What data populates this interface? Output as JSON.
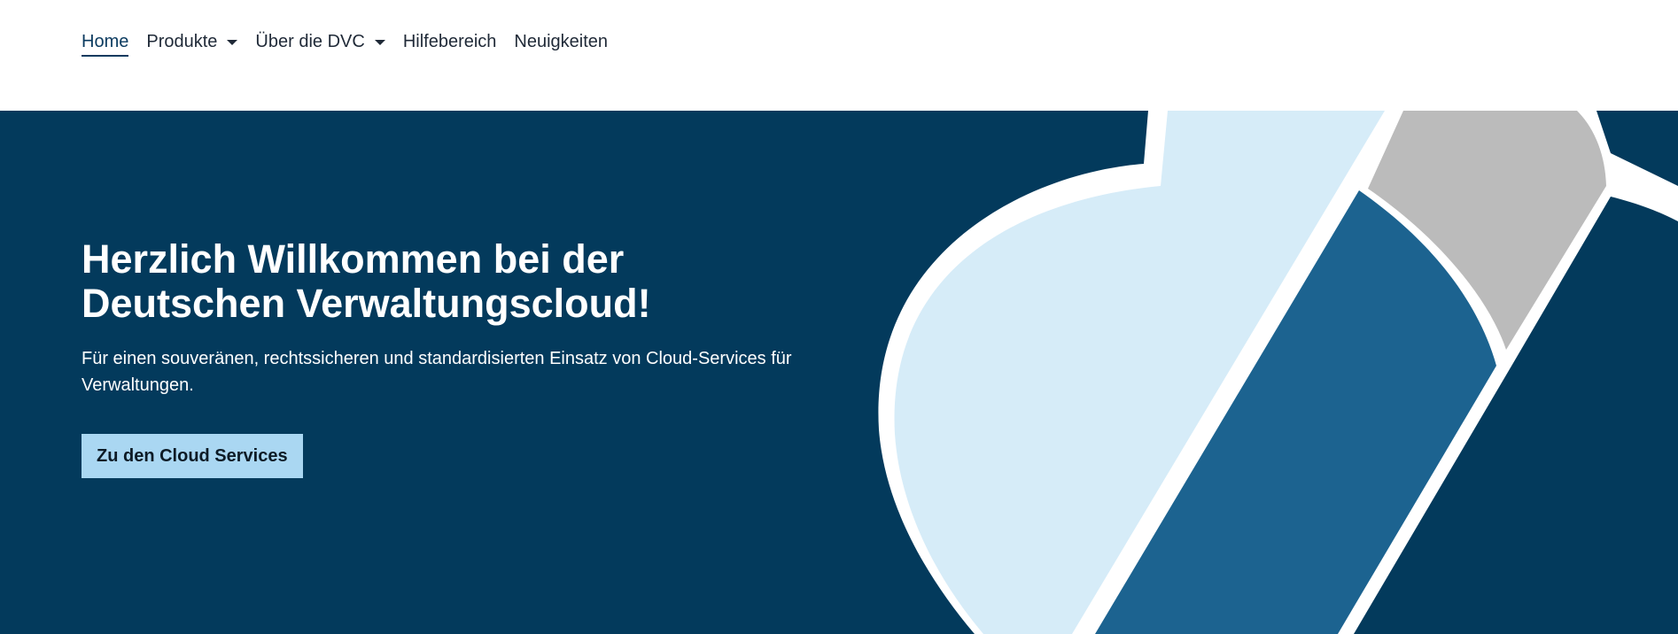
{
  "nav": {
    "items": [
      {
        "label": "Home",
        "active": true,
        "has_dropdown": false
      },
      {
        "label": "Produkte",
        "active": false,
        "has_dropdown": true
      },
      {
        "label": "Über die DVC",
        "active": false,
        "has_dropdown": true
      },
      {
        "label": "Hilfebereich",
        "active": false,
        "has_dropdown": false
      },
      {
        "label": "Neuigkeiten",
        "active": false,
        "has_dropdown": false
      }
    ]
  },
  "hero": {
    "title": "Herzlich Willkommen bei der Deutschen Verwaltungscloud!",
    "subtitle": "Für einen souveränen, rechtssicheren und standardisierten Einsatz von Cloud-Services für Verwaltungen.",
    "cta_label": "Zu den Cloud Services"
  },
  "colors": {
    "hero_background": "#033a5c",
    "cta_background": "#aad7f2",
    "nav_active": "#0a3a5f",
    "graphic_light_blue": "#d6ecf8",
    "graphic_mid_blue": "#1c6390",
    "graphic_gray": "#bbbbbb"
  }
}
